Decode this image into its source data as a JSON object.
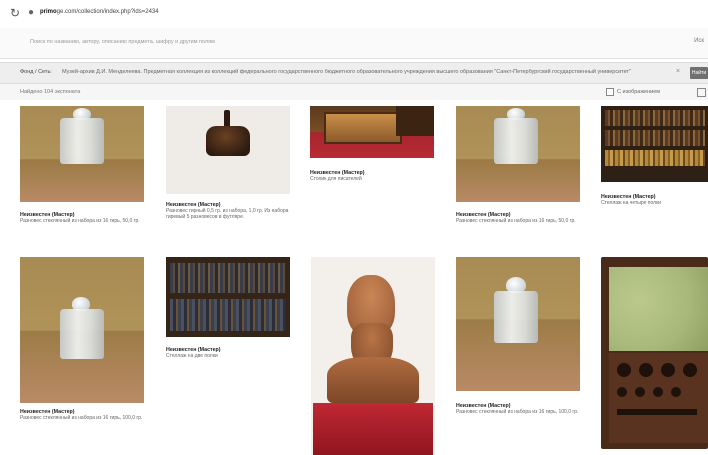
{
  "browser": {
    "url_host": "primo",
    "url_path": "ge.com/collection/index.php?ids=2434"
  },
  "search": {
    "placeholder": "Поиск по названию, автору, описанию предмета, шифру и другим полям",
    "button_label": "Иск"
  },
  "filter": {
    "label": "Фонд / Сеть:",
    "value": "Музей-архив Д.И. Менделеева. Предметная коллекция из коллекций федерального государственного бюджетного образовательного учреждения высшего образования \"Санкт-Петербургский государственный университет\"",
    "clear_symbol": "×",
    "go_label": "Найти"
  },
  "results": {
    "count_text": "Найдено 104 экспоната",
    "with_images_label": "С изображением"
  },
  "items": [
    {
      "author": "Неизвестен (Мастер)",
      "title": "Разновес стеклянный из набора из 16 гирь, 50,0 гр."
    },
    {
      "author": "Неизвестен (Мастер)",
      "title": "Разновес гирный 0,5 гр. из набора, 1,0 гр. Из набора гиревый 5 разновесов в футляре."
    },
    {
      "author": "Неизвестен (Мастер)",
      "title": "Столик для писателей"
    },
    {
      "author": "Неизвестен (Мастер)",
      "title": "Разновес стеклянный из набора из 16 гирь, 50,0 гр."
    },
    {
      "author": "Неизвестен (Мастер)",
      "title": "Стеллаж на четыре полки"
    },
    {
      "author": "Неизвестен (Мастер)",
      "title": "Разновес стеклянный из набора из 16 гирь, 100,0 гр."
    },
    {
      "author": "Неизвестен (Мастер)",
      "title": "Стеллаж на две полки"
    },
    {
      "author": "Неизвестен (Мастер)",
      "title": "Разновес стеклянный из набора из 16 гирь, 100,0 гр."
    }
  ],
  "colors": {
    "wood_bg": "#b09358",
    "table_top": "#b98a66",
    "bust": "#a8673f",
    "bust_base": "#b11d2a",
    "case_lining": "#a7b77a"
  }
}
